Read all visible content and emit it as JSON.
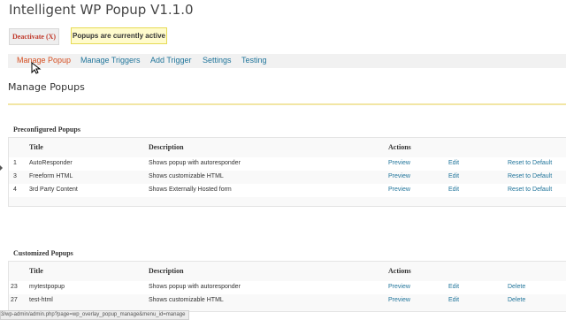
{
  "header": {
    "title": "Intelligent WP Popup V1.1.0",
    "deactivate_label": "Deactivate (X)",
    "notice": "Popups are currently active"
  },
  "tabs": [
    {
      "label": "Manage Popup",
      "active": true
    },
    {
      "label": "Manage Triggers",
      "active": false
    },
    {
      "label": "Add Trigger",
      "active": false
    },
    {
      "label": "Settings",
      "active": false
    },
    {
      "label": "Testing",
      "active": false
    }
  ],
  "main": {
    "heading": "Manage Popups"
  },
  "preconfigured": {
    "title": "Preconfigured Popups",
    "columns": [
      "Title",
      "Description",
      "Actions"
    ],
    "rows": [
      {
        "id": "1",
        "title": "AutoResponder",
        "description": "Shows popup with autoresponder",
        "preview": "Preview",
        "edit": "Edit",
        "action": "Reset to Default"
      },
      {
        "id": "3",
        "title": "Freeform HTML",
        "description": "Shows customizable HTML",
        "preview": "Preview",
        "edit": "Edit",
        "action": "Reset to Default"
      },
      {
        "id": "4",
        "title": "3rd Party Content",
        "description": "Shows Externally Hosted form",
        "preview": "Preview",
        "edit": "Edit",
        "action": "Reset to Default"
      }
    ]
  },
  "customized": {
    "title": "Customized Popups",
    "columns": [
      "Title",
      "Description",
      "Actions"
    ],
    "rows": [
      {
        "id": "23",
        "title": "mytestpopup",
        "description": "Shows popup with autoresponder",
        "preview": "Preview",
        "edit": "Edit",
        "action": "Delete"
      },
      {
        "id": "27",
        "title": "test-html",
        "description": "Shows customizable HTML",
        "preview": "Preview",
        "edit": "Edit",
        "action": "Delete"
      }
    ]
  },
  "status_bar": {
    "url": "3/wp-admin/admin.php?page=wp_overlay_popup_manage&menu_id=manage"
  },
  "colors": {
    "link": "#21759b",
    "active_tab": "#d54e21",
    "deactivate": "#c0392b",
    "notice_bg": "#fffbcc"
  }
}
